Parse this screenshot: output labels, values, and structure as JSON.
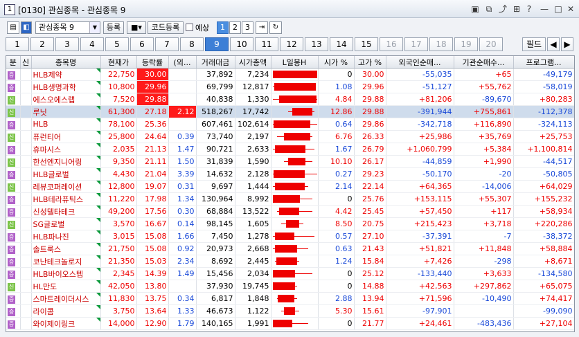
{
  "window": {
    "title": "[0130] 관심종목 - 관심종목 9",
    "app_icon": "1"
  },
  "toolbar": {
    "group_select": "관심종목 9",
    "register_label": "등록",
    "code_register_label": "코드등록",
    "forecast_label": "예상",
    "page_buttons": [
      "1",
      "2",
      "3"
    ]
  },
  "tabs": {
    "items": [
      "1",
      "2",
      "3",
      "4",
      "5",
      "6",
      "7",
      "8",
      "9",
      "10",
      "11",
      "12",
      "13",
      "14",
      "15",
      "16",
      "17",
      "18",
      "19",
      "20"
    ],
    "active_index": 8,
    "filter_label": "필드"
  },
  "grid": {
    "headers": [
      "분",
      "신",
      "종목명",
      "현재가",
      "등락률",
      "(외...",
      "거래대금",
      "시가총액",
      "L일봉H",
      "시가 %",
      "고가 %",
      "외국인순매...",
      "기관순매수...",
      "프로그램..."
    ],
    "rows": [
      {
        "badge": "증",
        "name": "HLB제약",
        "price": "22,750",
        "rate": "30.00",
        "hot": true,
        "foreign_pct": "",
        "volume": "37,892",
        "mcap": "7,234",
        "open": "0",
        "high": "30.00",
        "foreign": "-55,035",
        "inst": "+65",
        "prog": "-49,179",
        "candle": [
          0.0,
          1.0,
          0.0,
          1.0
        ]
      },
      {
        "badge": "증",
        "name": "HLB생명과학",
        "price": "10,800",
        "rate": "29.96",
        "hot": true,
        "foreign_pct": "",
        "volume": "69,799",
        "mcap": "12,817",
        "open": "1.08",
        "high": "29.96",
        "foreign": "-51,127",
        "inst": "+55,762",
        "prog": "-58,019",
        "candle": [
          0.0,
          0.97,
          0.04,
          0.97
        ]
      },
      {
        "badge": "신",
        "name": "에스오에스랩",
        "price": "7,520",
        "rate": "29.88",
        "hot": true,
        "foreign_pct": "",
        "volume": "40,838",
        "mcap": "1,330",
        "open": "4.84",
        "high": "29.88",
        "foreign": "+81,206",
        "inst": "-89,670",
        "prog": "+80,283",
        "candle": [
          0.0,
          1.0,
          0.15,
          1.0
        ]
      },
      {
        "badge": "신",
        "name": "루닛",
        "price": "61,300",
        "rate": "27.18",
        "hot": false,
        "foreign_pct": "2.12",
        "volume": "518,267",
        "mcap": "17,742",
        "open": "12.86",
        "high": "29.88",
        "foreign": "-391,944",
        "inst": "+755,861",
        "prog": "-112,378",
        "candle": [
          0.35,
          0.95,
          0.45,
          0.9
        ],
        "selected": true
      },
      {
        "badge": "증",
        "name": "HLB",
        "price": "78,100",
        "rate": "25.36",
        "hot": false,
        "foreign_pct": "",
        "volume": "607,461",
        "mcap": "102,614",
        "open": "0.64",
        "high": "29.86",
        "foreign": "-342,718",
        "inst": "+116,890",
        "prog": "-324,113",
        "candle": [
          0.0,
          1.0,
          0.02,
          0.85
        ]
      },
      {
        "badge": "신",
        "name": "퓨런티어",
        "price": "25,800",
        "rate": "24.64",
        "hot": false,
        "foreign_pct": "0.39",
        "volume": "73,740",
        "mcap": "2,197",
        "open": "6.76",
        "high": "26.33",
        "foreign": "+25,986",
        "inst": "+35,769",
        "prog": "+25,753",
        "candle": [
          0.1,
          0.9,
          0.25,
          0.85
        ]
      },
      {
        "badge": "증",
        "name": "휴마시스",
        "price": "2,035",
        "rate": "21.13",
        "hot": false,
        "foreign_pct": "1.47",
        "volume": "90,721",
        "mcap": "2,633",
        "open": "1.67",
        "high": "26.79",
        "foreign": "+1,060,799",
        "inst": "+5,384",
        "prog": "+1,100,814",
        "candle": [
          0.0,
          0.95,
          0.05,
          0.75
        ]
      },
      {
        "badge": "신",
        "name": "한선엔지니어링",
        "price": "9,350",
        "rate": "21.11",
        "hot": false,
        "foreign_pct": "1.50",
        "volume": "31,839",
        "mcap": "1,590",
        "open": "10.10",
        "high": "26.17",
        "foreign": "-44,859",
        "inst": "+1,990",
        "prog": "-44,517",
        "candle": [
          0.25,
          0.9,
          0.35,
          0.75
        ]
      },
      {
        "badge": "증",
        "name": "HLB글로벌",
        "price": "4,430",
        "rate": "21.04",
        "hot": false,
        "foreign_pct": "3.39",
        "volume": "14,632",
        "mcap": "2,128",
        "open": "0.27",
        "high": "29.23",
        "foreign": "-50,170",
        "inst": "-20",
        "prog": "-50,805",
        "candle": [
          0.0,
          1.0,
          0.02,
          0.72
        ]
      },
      {
        "badge": "신",
        "name": "레뷰코퍼레이션",
        "price": "12,800",
        "rate": "19.07",
        "hot": false,
        "foreign_pct": "0.31",
        "volume": "9,697",
        "mcap": "1,444",
        "open": "2.14",
        "high": "22.14",
        "foreign": "+64,365",
        "inst": "-14,006",
        "prog": "+64,029",
        "candle": [
          0.0,
          0.8,
          0.05,
          0.72
        ]
      },
      {
        "badge": "증",
        "name": "HLB테라퓨틱스",
        "price": "11,220",
        "rate": "17.98",
        "hot": false,
        "foreign_pct": "1.34",
        "volume": "130,964",
        "mcap": "8,992",
        "open": "0",
        "high": "25.76",
        "foreign": "+153,115",
        "inst": "+55,307",
        "prog": "+155,232",
        "candle": [
          0.0,
          0.9,
          0.0,
          0.62
        ]
      },
      {
        "badge": "증",
        "name": "신성델타테크",
        "price": "49,200",
        "rate": "17.56",
        "hot": false,
        "foreign_pct": "0.30",
        "volume": "68,884",
        "mcap": "13,522",
        "open": "4.42",
        "high": "25.45",
        "foreign": "+57,450",
        "inst": "+117",
        "prog": "+58,934",
        "candle": [
          0.1,
          0.9,
          0.15,
          0.6
        ]
      },
      {
        "badge": "신",
        "name": "SG글로벌",
        "price": "3,570",
        "rate": "16.67",
        "hot": false,
        "foreign_pct": "0.14",
        "volume": "98,145",
        "mcap": "1,605",
        "open": "8.50",
        "high": "20.75",
        "foreign": "+215,423",
        "inst": "+3,718",
        "prog": "+220,286",
        "candle": [
          0.2,
          0.7,
          0.3,
          0.6
        ]
      },
      {
        "badge": "증",
        "name": "HLB파나진",
        "price": "3,015",
        "rate": "15.08",
        "hot": false,
        "foreign_pct": "1.66",
        "volume": "7,450",
        "mcap": "1,278",
        "open": "0.57",
        "high": "27.10",
        "foreign": "-37,391",
        "inst": "-7",
        "prog": "-38,372",
        "candle": [
          0.0,
          0.95,
          0.05,
          0.5
        ]
      },
      {
        "badge": "증",
        "name": "솔트룩스",
        "price": "21,750",
        "rate": "15.08",
        "hot": false,
        "foreign_pct": "0.92",
        "volume": "20,973",
        "mcap": "2,668",
        "open": "0.63",
        "high": "21.43",
        "foreign": "+51,821",
        "inst": "+11,848",
        "prog": "+58,884",
        "candle": [
          0.0,
          0.8,
          0.05,
          0.55
        ]
      },
      {
        "badge": "증",
        "name": "코난테크놀로지",
        "price": "21,350",
        "rate": "15.03",
        "hot": false,
        "foreign_pct": "2.34",
        "volume": "8,692",
        "mcap": "2,445",
        "open": "1.24",
        "high": "15.84",
        "foreign": "+7,426",
        "inst": "-298",
        "prog": "+8,671",
        "candle": [
          0.05,
          0.6,
          0.08,
          0.55
        ]
      },
      {
        "badge": "증",
        "name": "HLB바이오스텝",
        "price": "2,345",
        "rate": "14.39",
        "hot": false,
        "foreign_pct": "1.49",
        "volume": "15,456",
        "mcap": "2,034",
        "open": "0",
        "high": "25.12",
        "foreign": "-133,440",
        "inst": "+3,633",
        "prog": "-134,580",
        "candle": [
          0.0,
          0.9,
          0.0,
          0.5
        ]
      },
      {
        "badge": "신",
        "name": "HL만도",
        "price": "42,050",
        "rate": "13.80",
        "hot": false,
        "foreign_pct": "",
        "volume": "37,930",
        "mcap": "19,745",
        "open": "0",
        "high": "14.88",
        "foreign": "+42,563",
        "inst": "+297,862",
        "prog": "+65,075",
        "candle": [
          0.0,
          0.55,
          0.0,
          0.5
        ]
      },
      {
        "badge": "증",
        "name": "스마트레이더시스",
        "price": "11,830",
        "rate": "13.75",
        "hot": false,
        "foreign_pct": "0.34",
        "volume": "6,817",
        "mcap": "1,848",
        "open": "2.88",
        "high": "13.94",
        "foreign": "+71,596",
        "inst": "-10,490",
        "prog": "+74,417",
        "candle": [
          0.1,
          0.55,
          0.12,
          0.5
        ]
      },
      {
        "badge": "증",
        "name": "라이콤",
        "price": "3,750",
        "rate": "13.64",
        "hot": false,
        "foreign_pct": "1.33",
        "volume": "46,673",
        "mcap": "1,122",
        "open": "5.30",
        "high": "15.61",
        "foreign": "-97,901",
        "inst": "",
        "prog": "-99,090",
        "candle": [
          0.2,
          0.6,
          0.25,
          0.5
        ]
      },
      {
        "badge": "증",
        "name": "와이제이링크",
        "price": "14,000",
        "rate": "12.90",
        "hot": false,
        "foreign_pct": "1.79",
        "volume": "140,165",
        "mcap": "1,991",
        "open": "0",
        "high": "21.77",
        "foreign": "+24,461",
        "inst": "-483,436",
        "prog": "+27,104",
        "candle": [
          0.0,
          0.8,
          0.0,
          0.45
        ]
      }
    ]
  }
}
